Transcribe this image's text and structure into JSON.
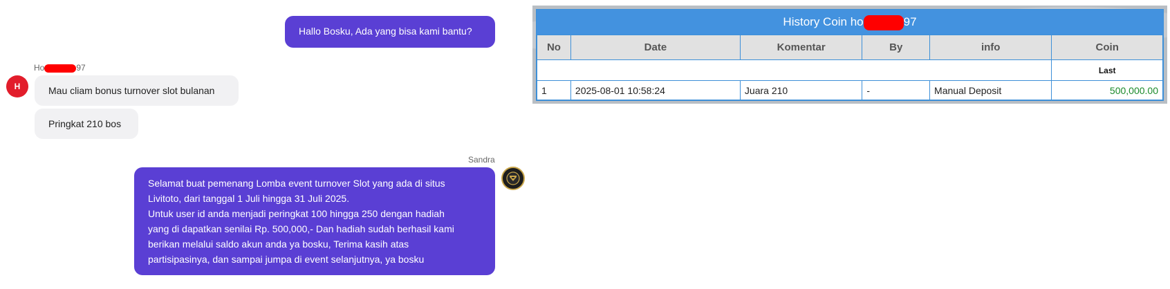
{
  "chat": {
    "messages": [
      {
        "direction": "out",
        "text": "Hallo Bosku, Ada yang bisa kami bantu?"
      },
      {
        "direction": "in",
        "sender_prefix": "Ho",
        "sender_suffix": "97",
        "avatar_letter": "H",
        "text": "Mau cliam bonus turnover slot bulanan"
      },
      {
        "direction": "in",
        "text": "Pringkat 210 bos"
      },
      {
        "direction": "out",
        "sender": "Sandra",
        "lines": [
          "Selamat buat pemenang Lomba event turnover Slot yang ada di situs",
          "Livitoto, dari tanggal 1 Juli hingga 31 Juli 2025.",
          "Untuk user id anda menjadi peringkat 100 hingga 250 dengan hadiah",
          "yang di dapatkan senilai Rp. 500,000,- Dan hadiah sudah berhasil kami",
          "berikan melalui saldo akun anda ya bosku, Terima kasih atas",
          "partisipasinya, dan sampai jumpa di event selanjutnya, ya bosku"
        ]
      }
    ],
    "colors": {
      "outgoing_bubble": "#5a3fd4",
      "incoming_bubble": "#f1f1f3",
      "avatar_user": "#e21d2b",
      "redaction": "#ff0000"
    }
  },
  "history": {
    "title_prefix": "History Coin ho",
    "title_suffix": "97",
    "columns": [
      "No",
      "Date",
      "Komentar",
      "By",
      "info",
      "Coin"
    ],
    "sub_header_coin": "Last",
    "rows": [
      {
        "no": "1",
        "date": "2025-08-01 10:58:24",
        "komentar": "Juara 210",
        "by": "-",
        "info": "Manual Deposit",
        "coin": "500,000.00"
      }
    ],
    "colors": {
      "title_bar": "#4392df",
      "border": "#3c8fd8",
      "header_bg": "#e1e1e1",
      "coin_text": "#1a8a2a"
    }
  }
}
